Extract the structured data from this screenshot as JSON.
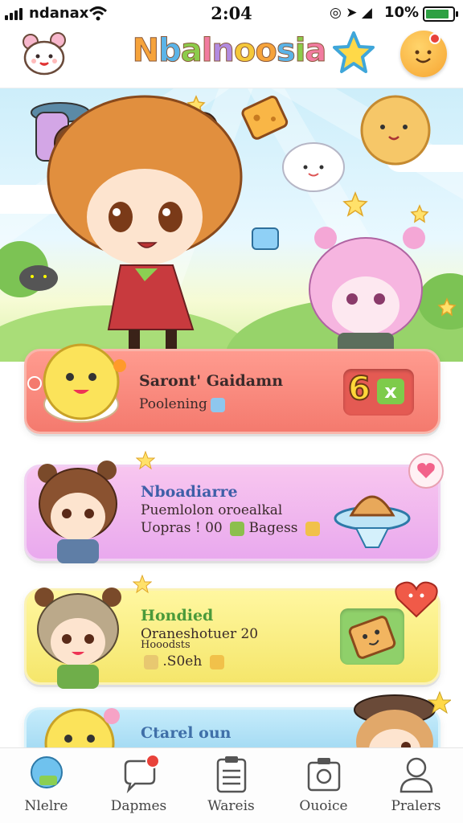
{
  "status_bar": {
    "carrier": "ndanax",
    "time": "2:04",
    "battery_pct": "10%"
  },
  "header": {
    "app_title": "Nbalnoosia"
  },
  "cards": [
    {
      "title": "Saront' Gaidamn",
      "line1": "Poolening",
      "multiplier": "6",
      "multiplier_x": "x"
    },
    {
      "title": "Nboadiarre",
      "line1": "Puemlolon oroealkal",
      "line2": "Uopras ! 00",
      "line2b": "Bagess"
    },
    {
      "title": "Hondied",
      "line1": "Oraneshotuer 20",
      "line2": "Hooodsts",
      "line3": ".S0eh"
    },
    {
      "title": "Ctarel oun"
    }
  ],
  "bottom_nav": [
    {
      "label": "Nlelre",
      "icon": "home-icon"
    },
    {
      "label": "Dapmes",
      "icon": "chat-icon"
    },
    {
      "label": "Wareis",
      "icon": "clipboard-icon"
    },
    {
      "label": "Ouoice",
      "icon": "camera-icon"
    },
    {
      "label": "Pralers",
      "icon": "profile-icon"
    }
  ],
  "colors": {
    "card1": "#f47a6e",
    "card2": "#e9a9ee",
    "card3": "#f5e66b",
    "card4": "#9fd8f2",
    "accent_red": "#e8423a"
  }
}
